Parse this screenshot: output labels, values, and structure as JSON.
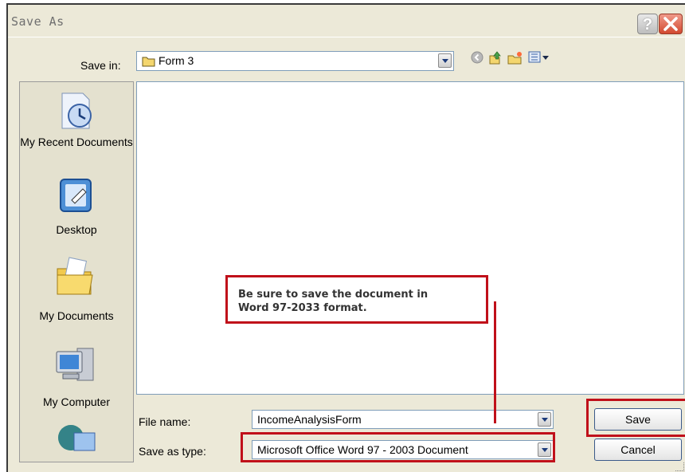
{
  "dialog": {
    "title": "Save As"
  },
  "toolbar": {
    "save_in_label": "Save in:",
    "save_in_value": "Form 3"
  },
  "places": [
    {
      "label": "My Recent Documents",
      "icon": "recent-documents-icon"
    },
    {
      "label": "Desktop",
      "icon": "desktop-icon"
    },
    {
      "label": "My Documents",
      "icon": "my-documents-icon"
    },
    {
      "label": "My Computer",
      "icon": "my-computer-icon"
    }
  ],
  "form": {
    "file_name_label": "File name:",
    "file_name_value": "IncomeAnalysisForm",
    "save_type_label": "Save as type:",
    "save_type_value": "Microsoft Office Word 97 - 2003 Document"
  },
  "buttons": {
    "save": "Save",
    "cancel": "Cancel"
  },
  "annotation": {
    "line1": "Be sure to save the document in",
    "line2": "Word 97-2033 format."
  },
  "colors": {
    "annotation_red": "#c0101a",
    "dialog_bg": "#ece9d8"
  }
}
